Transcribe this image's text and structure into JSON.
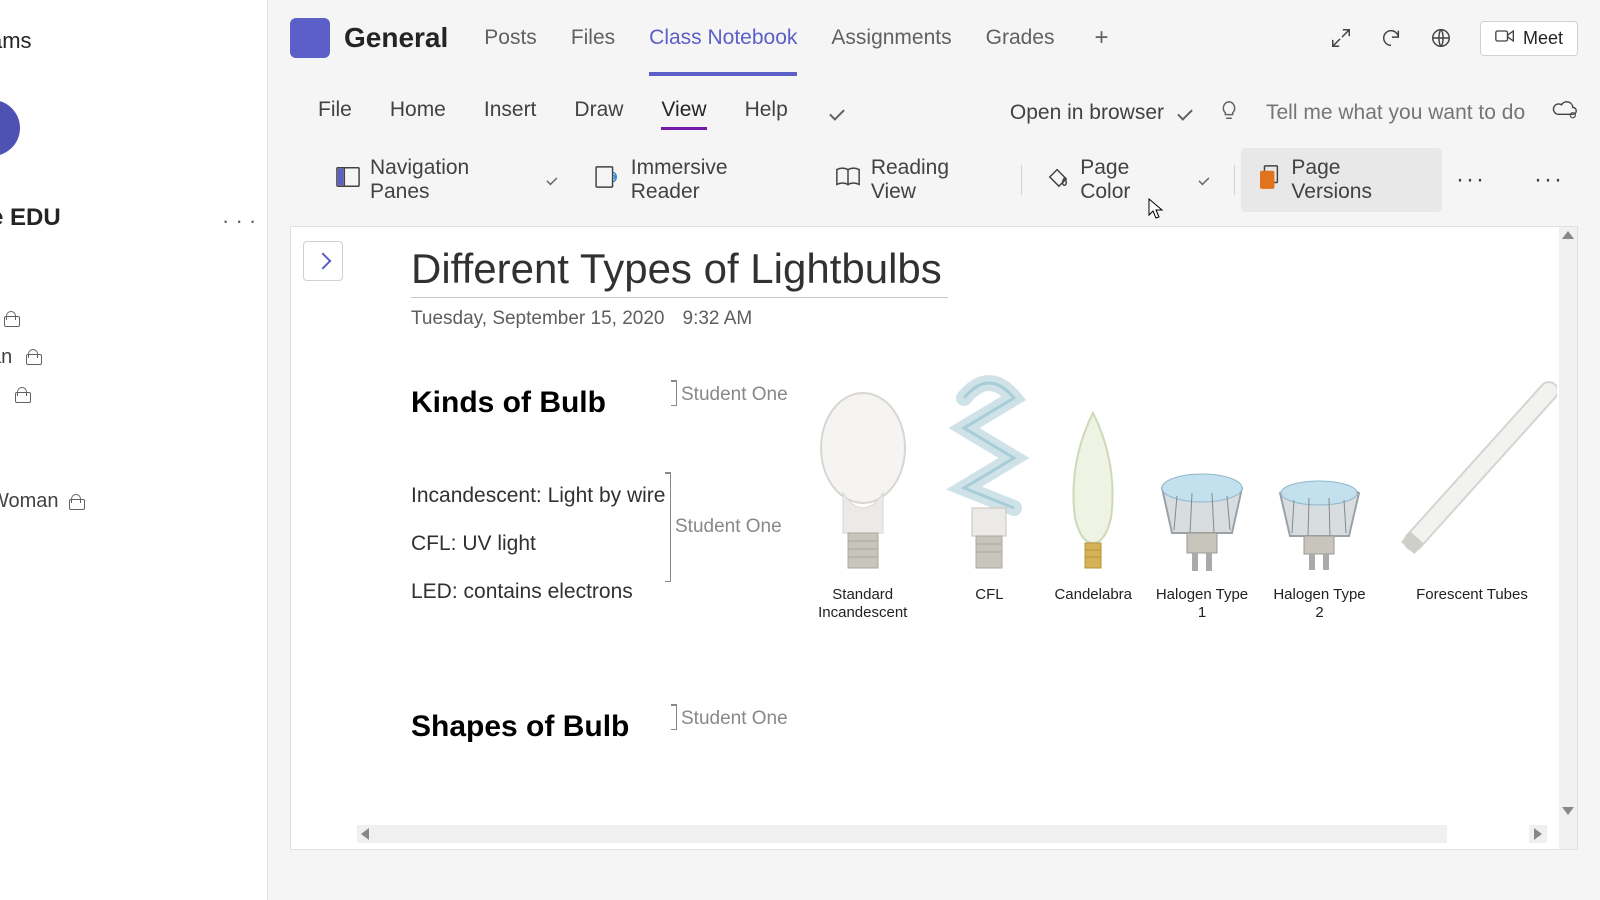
{
  "sidebar": {
    "top_label": "ams",
    "title": "e EDU",
    "items": [
      {
        "text": ""
      },
      {
        "text": "an"
      },
      {
        "text": "n"
      }
    ],
    "special_item": "Woman"
  },
  "header": {
    "channel_name": "General",
    "tabs": [
      "Posts",
      "Files",
      "Class Notebook",
      "Assignments",
      "Grades"
    ],
    "active_tab": 2,
    "meet_label": "Meet"
  },
  "notebook": {
    "menus": [
      "File",
      "Home",
      "Insert",
      "Draw",
      "View",
      "Help"
    ],
    "active_menu": 4,
    "open_browser_label": "Open in browser",
    "tell_me_placeholder": "Tell me what you want to do",
    "toolbar": {
      "nav_panes": "Navigation Panes",
      "immersive": "Immersive Reader",
      "reading": "Reading View",
      "page_color": "Page Color",
      "page_versions": "Page Versions"
    }
  },
  "page": {
    "title": "Different Types of Lightbulbs",
    "date": "Tuesday, September 15, 2020",
    "time": "9:32 AM",
    "section1_heading": "Kinds of Bulb",
    "section1_author": "Student One",
    "bullets": [
      "Incandescent: Light by wire",
      "CFL: UV light",
      "LED: contains electrons"
    ],
    "bullets_author": "Student One",
    "section2_heading": "Shapes of Bulb",
    "section2_author": "Student One",
    "bulb_captions": [
      "Standard Incandescent",
      "CFL",
      "Candelabra",
      "Halogen Type 1",
      "Halogen Type 2",
      "Forescent Tubes"
    ]
  }
}
